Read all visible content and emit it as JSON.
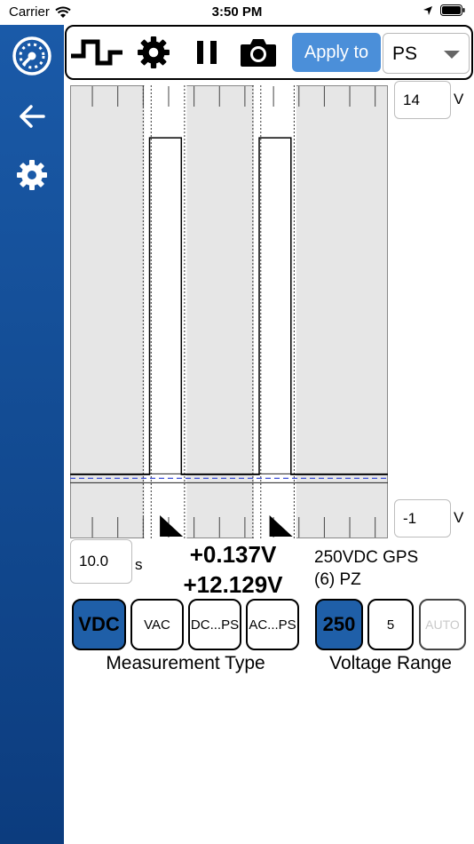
{
  "status": {
    "carrier": "Carrier",
    "time": "3:50 PM"
  },
  "sidebar": {
    "items": [
      {
        "icon": "dashboard-gauge-icon"
      },
      {
        "icon": "back-arrow-icon"
      },
      {
        "icon": "gear-icon"
      }
    ],
    "color": "#1a5aa8"
  },
  "toolbar": {
    "waveform_icon": "square-wave-icon",
    "settings_icon": "gear-icon",
    "pause_icon": "pause-icon",
    "camera_icon": "camera-icon",
    "apply_label": "Apply to",
    "apply_color": "#4b8fd9",
    "select_value": "PS"
  },
  "scope": {
    "y_max": "14",
    "y_min": "-1",
    "y_unit": "V",
    "time_value": "10.0",
    "time_unit": "s",
    "readout_low": "+0.137V",
    "readout_high": "+12.129V",
    "probe_line1": "250VDC GPS",
    "probe_line2": "(6) PZ"
  },
  "chart_data": {
    "type": "line",
    "ylim": [
      -1,
      14
    ],
    "xlim": [
      0,
      10
    ],
    "grid": false,
    "x_ticks": [
      0.7,
      1.5,
      2.3,
      3.1,
      3.9,
      4.7,
      5.5,
      6.4,
      7.2,
      8.0,
      8.8,
      9.6
    ],
    "cursor_y": 0,
    "series": [
      {
        "x": [
          0,
          2.5,
          2.5,
          3.5,
          3.5,
          5.95,
          5.95,
          6.95,
          6.95,
          10
        ],
        "values": [
          0.137,
          0.137,
          12.129,
          12.129,
          0.137,
          0.137,
          12.129,
          12.129,
          0.137,
          0.137
        ]
      }
    ],
    "markers": [
      {
        "x": 2.3,
        "y_from": -0.35,
        "y_to": 14
      },
      {
        "x": 2.55,
        "y_from": -0.35,
        "y_to": 14
      },
      {
        "x": 3.6,
        "y_from": -0.35,
        "y_to": 14
      },
      {
        "x": 5.75,
        "y_from": -0.35,
        "y_to": 14
      },
      {
        "x": 6.0,
        "y_from": -0.35,
        "y_to": 14
      },
      {
        "x": 7.05,
        "y_from": -0.35,
        "y_to": 14
      }
    ],
    "cursor_triangles": [
      3.55,
      7.0
    ]
  },
  "measurement": {
    "buttons": [
      {
        "label": "VDC",
        "selected": true
      },
      {
        "label": "VAC",
        "selected": false
      },
      {
        "label": "DC...PS",
        "selected": false
      },
      {
        "label": "AC...PS",
        "selected": false
      }
    ],
    "caption": "Measurement Type"
  },
  "range": {
    "buttons": [
      {
        "label": "250",
        "selected": true
      },
      {
        "label": "5",
        "selected": false
      },
      {
        "label": "AUTO",
        "selected": false,
        "disabled": true
      }
    ],
    "caption": "Voltage Range"
  },
  "colors": {
    "selected": "#1f5fa8",
    "plot_bg": "#e6e6e6",
    "cursor": "#3c4fd6"
  }
}
